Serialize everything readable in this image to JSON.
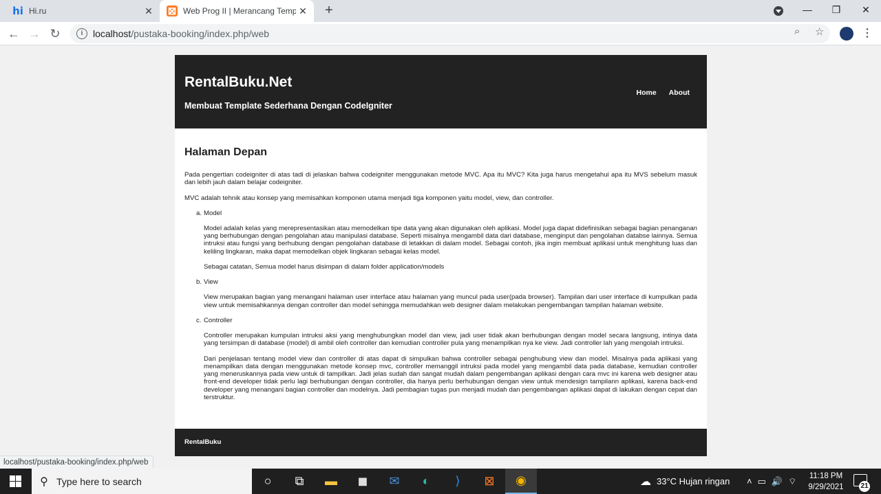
{
  "browser": {
    "tabs": [
      {
        "title": "Hi.ru",
        "icon": "hi-ru-favicon",
        "active": false
      },
      {
        "title": "Web Prog II | Merancang Templa",
        "icon": "xampp-favicon",
        "active": true
      }
    ],
    "new_tab": "+",
    "window": {
      "minimize": "—",
      "maximize": "❐",
      "close": "✕"
    },
    "address_url_host": "localhost",
    "address_url_path": "/pustaka-booking/index.php/web",
    "status_url": "localhost/pustaka-booking/index.php/web"
  },
  "page": {
    "site_title": "RentalBuku.Net",
    "site_subtitle": "Membuat Template Sederhana Dengan CodeIgniter",
    "nav": [
      "Home",
      "About"
    ],
    "heading": "Halaman Depan",
    "intro": "Pada pengertian codeigniter di atas tadi di jelaskan bahwa codeigniter menggunakan metode MVC. Apa itu MVC? Kita juga harus mengetahui apa itu MVS sebelum masuk dan lebih jauh dalam belajar codeigniter.",
    "mvc_def": "MVC adalah tehnik atau konsep yang memisahkan komponen utama menjadi tiga komponen yaitu model, view, dan controller.",
    "items": [
      {
        "marker": "a.",
        "title": "Model",
        "paras": [
          "Model adalah kelas yang merepresentasikan atau memodelkan tipe data yang akan digunakan oleh aplikasi. Model juga dapat didefinisikan sebagai bagian penanganan yang berhubungan dengan pengolahan atau manipulasi database. Seperti misalnya mengambil data dari database, menginput dan pengolahan databse lainnya. Semua intruksi atau fungsi yang berhubung dengan pengolahan database di letakkan di dalam model. Sebagai contoh, jika ingin membuat aplikasi untuk menghitung luas dan keliling lingkaran, maka dapat memodelkan objek lingkaran sebagai kelas model.",
          "Sebagai catatan, Semua model harus disimpan di dalam folder application/models"
        ]
      },
      {
        "marker": "b.",
        "title": "View",
        "paras": [
          "View merupakan bagian yang menangani halaman user interface atau halaman yang muncul pada user(pada browser). Tampilan dari user interface di kumpulkan pada view untuk memisahkannya dengan controller dan model sehingga memudahkan web designer dalam melakukan pengembangan tampilan halaman website."
        ]
      },
      {
        "marker": "c.",
        "title": "Controller",
        "paras": [
          "Controller merupakan kumpulan intruksi aksi yang menghubungkan model dan view, jadi user tidak akan berhubungan dengan model secara langsung, intinya data yang tersimpan di database (model) di ambil oleh controller dan kemudian controller pula yang menampilkan nya ke view. Jadi controller lah yang mengolah intruksi.",
          "Dari penjelasan tentang model view dan controller di atas dapat di simpulkan bahwa controller sebagai penghubung view dan model. Misalnya pada aplikasi yang menampilkan data dengan menggunakan metode konsep mvc, controller memanggil intruksi pada model yang mengambil data pada database, kemudian controller yang meneruskannya pada view untuk di tampilkan. Jadi jelas sudah dan sangat mudah dalam pengembangan aplikasi dengan cara mvc ini karena web designer atau front-end developer tidak perlu lagi berhubungan dengan controller, dia hanya perlu berhubungan dengan view untuk mendesign tampilann aplikasi, karena back-end developer yang menangani bagian controller dan modelnya. Jadi pembagian tugas pun menjadi mudah dan pengembangan aplikasi dapat di lakukan dengan cepat dan terstruktur."
        ]
      }
    ],
    "footer": "RentalBuku"
  },
  "taskbar": {
    "search_placeholder": "Type here to search",
    "weather": "33°C  Hujan ringan",
    "time": "11:18 PM",
    "date": "9/29/2021",
    "notifications": "21"
  }
}
